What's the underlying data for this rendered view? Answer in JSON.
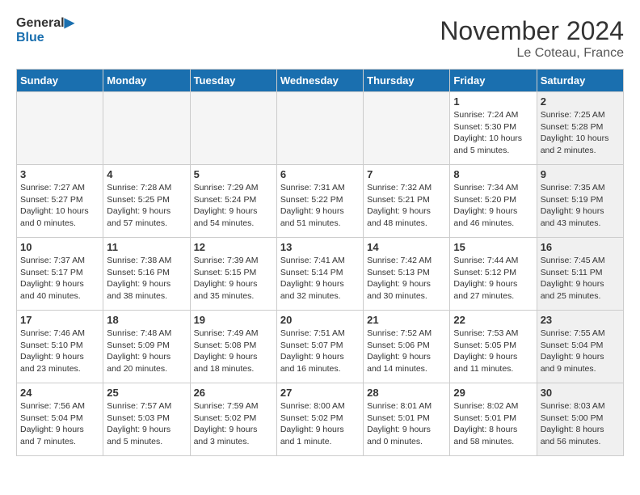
{
  "logo": {
    "line1": "General",
    "line2": "Blue"
  },
  "title": "November 2024",
  "location": "Le Coteau, France",
  "header": {
    "save_label": "November 2024"
  },
  "weekdays": [
    "Sunday",
    "Monday",
    "Tuesday",
    "Wednesday",
    "Thursday",
    "Friday",
    "Saturday"
  ],
  "weeks": [
    [
      {
        "day": "",
        "info": "",
        "empty": true
      },
      {
        "day": "",
        "info": "",
        "empty": true
      },
      {
        "day": "",
        "info": "",
        "empty": true
      },
      {
        "day": "",
        "info": "",
        "empty": true
      },
      {
        "day": "",
        "info": "",
        "empty": true
      },
      {
        "day": "1",
        "info": "Sunrise: 7:24 AM\nSunset: 5:30 PM\nDaylight: 10 hours\nand 5 minutes.",
        "empty": false,
        "shaded": false
      },
      {
        "day": "2",
        "info": "Sunrise: 7:25 AM\nSunset: 5:28 PM\nDaylight: 10 hours\nand 2 minutes.",
        "empty": false,
        "shaded": true
      }
    ],
    [
      {
        "day": "3",
        "info": "Sunrise: 7:27 AM\nSunset: 5:27 PM\nDaylight: 10 hours\nand 0 minutes.",
        "empty": false,
        "shaded": false
      },
      {
        "day": "4",
        "info": "Sunrise: 7:28 AM\nSunset: 5:25 PM\nDaylight: 9 hours\nand 57 minutes.",
        "empty": false,
        "shaded": false
      },
      {
        "day": "5",
        "info": "Sunrise: 7:29 AM\nSunset: 5:24 PM\nDaylight: 9 hours\nand 54 minutes.",
        "empty": false,
        "shaded": false
      },
      {
        "day": "6",
        "info": "Sunrise: 7:31 AM\nSunset: 5:22 PM\nDaylight: 9 hours\nand 51 minutes.",
        "empty": false,
        "shaded": false
      },
      {
        "day": "7",
        "info": "Sunrise: 7:32 AM\nSunset: 5:21 PM\nDaylight: 9 hours\nand 48 minutes.",
        "empty": false,
        "shaded": false
      },
      {
        "day": "8",
        "info": "Sunrise: 7:34 AM\nSunset: 5:20 PM\nDaylight: 9 hours\nand 46 minutes.",
        "empty": false,
        "shaded": false
      },
      {
        "day": "9",
        "info": "Sunrise: 7:35 AM\nSunset: 5:19 PM\nDaylight: 9 hours\nand 43 minutes.",
        "empty": false,
        "shaded": true
      }
    ],
    [
      {
        "day": "10",
        "info": "Sunrise: 7:37 AM\nSunset: 5:17 PM\nDaylight: 9 hours\nand 40 minutes.",
        "empty": false,
        "shaded": false
      },
      {
        "day": "11",
        "info": "Sunrise: 7:38 AM\nSunset: 5:16 PM\nDaylight: 9 hours\nand 38 minutes.",
        "empty": false,
        "shaded": false
      },
      {
        "day": "12",
        "info": "Sunrise: 7:39 AM\nSunset: 5:15 PM\nDaylight: 9 hours\nand 35 minutes.",
        "empty": false,
        "shaded": false
      },
      {
        "day": "13",
        "info": "Sunrise: 7:41 AM\nSunset: 5:14 PM\nDaylight: 9 hours\nand 32 minutes.",
        "empty": false,
        "shaded": false
      },
      {
        "day": "14",
        "info": "Sunrise: 7:42 AM\nSunset: 5:13 PM\nDaylight: 9 hours\nand 30 minutes.",
        "empty": false,
        "shaded": false
      },
      {
        "day": "15",
        "info": "Sunrise: 7:44 AM\nSunset: 5:12 PM\nDaylight: 9 hours\nand 27 minutes.",
        "empty": false,
        "shaded": false
      },
      {
        "day": "16",
        "info": "Sunrise: 7:45 AM\nSunset: 5:11 PM\nDaylight: 9 hours\nand 25 minutes.",
        "empty": false,
        "shaded": true
      }
    ],
    [
      {
        "day": "17",
        "info": "Sunrise: 7:46 AM\nSunset: 5:10 PM\nDaylight: 9 hours\nand 23 minutes.",
        "empty": false,
        "shaded": false
      },
      {
        "day": "18",
        "info": "Sunrise: 7:48 AM\nSunset: 5:09 PM\nDaylight: 9 hours\nand 20 minutes.",
        "empty": false,
        "shaded": false
      },
      {
        "day": "19",
        "info": "Sunrise: 7:49 AM\nSunset: 5:08 PM\nDaylight: 9 hours\nand 18 minutes.",
        "empty": false,
        "shaded": false
      },
      {
        "day": "20",
        "info": "Sunrise: 7:51 AM\nSunset: 5:07 PM\nDaylight: 9 hours\nand 16 minutes.",
        "empty": false,
        "shaded": false
      },
      {
        "day": "21",
        "info": "Sunrise: 7:52 AM\nSunset: 5:06 PM\nDaylight: 9 hours\nand 14 minutes.",
        "empty": false,
        "shaded": false
      },
      {
        "day": "22",
        "info": "Sunrise: 7:53 AM\nSunset: 5:05 PM\nDaylight: 9 hours\nand 11 minutes.",
        "empty": false,
        "shaded": false
      },
      {
        "day": "23",
        "info": "Sunrise: 7:55 AM\nSunset: 5:04 PM\nDaylight: 9 hours\nand 9 minutes.",
        "empty": false,
        "shaded": true
      }
    ],
    [
      {
        "day": "24",
        "info": "Sunrise: 7:56 AM\nSunset: 5:04 PM\nDaylight: 9 hours\nand 7 minutes.",
        "empty": false,
        "shaded": false
      },
      {
        "day": "25",
        "info": "Sunrise: 7:57 AM\nSunset: 5:03 PM\nDaylight: 9 hours\nand 5 minutes.",
        "empty": false,
        "shaded": false
      },
      {
        "day": "26",
        "info": "Sunrise: 7:59 AM\nSunset: 5:02 PM\nDaylight: 9 hours\nand 3 minutes.",
        "empty": false,
        "shaded": false
      },
      {
        "day": "27",
        "info": "Sunrise: 8:00 AM\nSunset: 5:02 PM\nDaylight: 9 hours\nand 1 minute.",
        "empty": false,
        "shaded": false
      },
      {
        "day": "28",
        "info": "Sunrise: 8:01 AM\nSunset: 5:01 PM\nDaylight: 9 hours\nand 0 minutes.",
        "empty": false,
        "shaded": false
      },
      {
        "day": "29",
        "info": "Sunrise: 8:02 AM\nSunset: 5:01 PM\nDaylight: 8 hours\nand 58 minutes.",
        "empty": false,
        "shaded": false
      },
      {
        "day": "30",
        "info": "Sunrise: 8:03 AM\nSunset: 5:00 PM\nDaylight: 8 hours\nand 56 minutes.",
        "empty": false,
        "shaded": true
      }
    ]
  ]
}
